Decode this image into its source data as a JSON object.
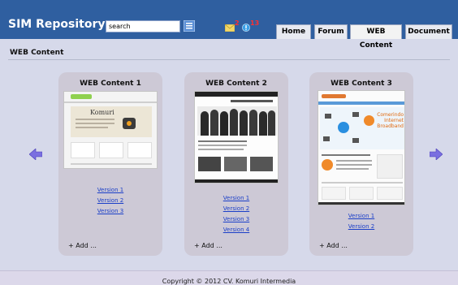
{
  "header": {
    "app_title": "SIM Repository",
    "search_value": "search",
    "mail_count": "2",
    "notification_count": "13"
  },
  "nav": {
    "tabs": [
      {
        "label": "Home"
      },
      {
        "label": "Forum"
      },
      {
        "label": "WEB Content"
      },
      {
        "label": "Document"
      }
    ],
    "active": "WEB Content"
  },
  "page": {
    "title": "WEB Content"
  },
  "cards": [
    {
      "title": "WEB Content 1",
      "thumb_text": "Komuri",
      "versions": [
        "Version 1",
        "Version 2",
        "Version 3"
      ],
      "add_label": "+ Add ..."
    },
    {
      "title": "WEB Content 2",
      "versions": [
        "Version 1",
        "Version 2",
        "Version 3",
        "Version 4"
      ],
      "add_label": "+ Add ..."
    },
    {
      "title": "WEB Content 3",
      "thumb_text": [
        "Comerindo",
        "Internet",
        "Broadband"
      ],
      "versions": [
        "Version 1",
        "Version 2"
      ],
      "add_label": "+ Add ..."
    }
  ],
  "footer": {
    "copyright": "Copyright © 2012 CV. Komuri Intermedia"
  },
  "colors": {
    "header": "#2f5fa0",
    "background": "#d6d9ea",
    "card": "#cdc9d6",
    "link": "#1b3fc8",
    "arrow": "#7a6fe0",
    "badge": "#ff3030"
  }
}
